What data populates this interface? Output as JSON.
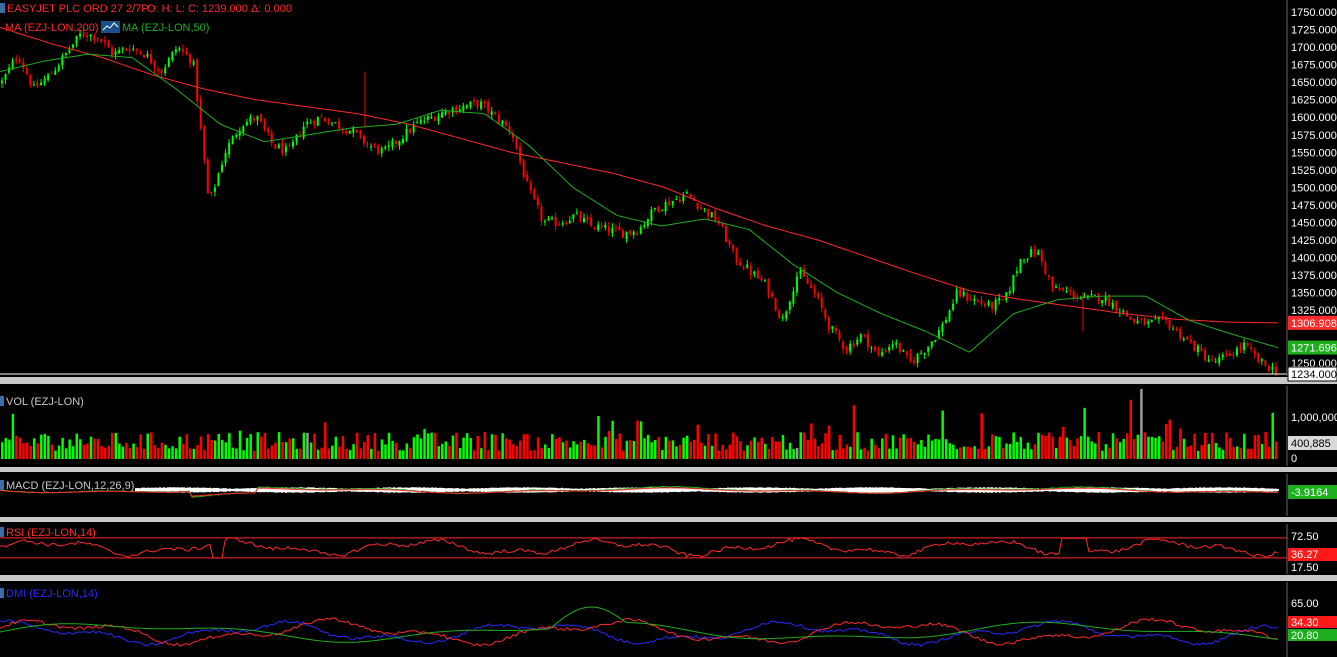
{
  "header": {
    "instrument": "EASYJET PLC ORD 27 2/7P",
    "ohlc": "O:    H:    L:    C: 1239.000   Δ: 0.000",
    "ma200_label": "MA (EZJ-LON,200)",
    "ma50_label": "MA (EZJ-LON,50)"
  },
  "colors": {
    "background": "#000000",
    "up": "#00ff00",
    "down": "#ff0000",
    "ma200": "#ff2a2a",
    "ma50": "#1fae1f",
    "separator": "#c8c8c8",
    "dmi_plus": "#2a2aff",
    "dmi_minus": "#ff2a2a",
    "adx": "#1fae1f"
  },
  "chart_data": [
    {
      "type": "candlestick",
      "title": "EASYJET PLC ORD 27 2/7P",
      "ylim": [
        1234,
        1750
      ],
      "y_ticks": [
        "1750.000",
        "1725.000",
        "1700.000",
        "1675.000",
        "1650.000",
        "1625.000",
        "1600.000",
        "1575.000",
        "1550.000",
        "1525.000",
        "1500.000",
        "1475.000",
        "1450.000",
        "1425.000",
        "1400.000",
        "1375.000",
        "1350.000",
        "1325.000",
        "1250.000"
      ],
      "price_path": [
        1650,
        1690,
        1640,
        1660,
        1690,
        1720,
        1715,
        1690,
        1700,
        1690,
        1665,
        1700,
        1680,
        1475,
        1550,
        1590,
        1600,
        1560,
        1550,
        1590,
        1600,
        1590,
        1580,
        1560,
        1550,
        1570,
        1590,
        1600,
        1610,
        1615,
        1620,
        1600,
        1580,
        1500,
        1450,
        1450,
        1460,
        1445,
        1440,
        1435,
        1440,
        1470,
        1480,
        1490,
        1470,
        1450,
        1400,
        1380,
        1360,
        1310,
        1380,
        1350,
        1300,
        1270,
        1290,
        1260,
        1280,
        1250,
        1270,
        1300,
        1350,
        1340,
        1330,
        1340,
        1400,
        1410,
        1355,
        1350,
        1340,
        1345,
        1330,
        1310,
        1305,
        1310,
        1290,
        1270,
        1250,
        1260,
        1275,
        1250,
        1239
      ],
      "series": [
        {
          "name": "MA (EZJ-LON,200)",
          "anchors": [
            1728,
            1705,
            1685,
            1660,
            1640,
            1625,
            1615,
            1605,
            1590,
            1570,
            1550,
            1535,
            1520,
            1500,
            1470,
            1445,
            1425,
            1400,
            1375,
            1352,
            1340,
            1330,
            1320,
            1312,
            1308,
            1306.9
          ]
        },
        {
          "name": "MA (EZJ-LON,50)",
          "anchors": [
            1665,
            1680,
            1690,
            1685,
            1640,
            1590,
            1565,
            1575,
            1585,
            1590,
            1610,
            1605,
            1560,
            1500,
            1460,
            1445,
            1455,
            1440,
            1390,
            1350,
            1320,
            1295,
            1265,
            1320,
            1340,
            1345,
            1345,
            1310,
            1290,
            1271.6
          ]
        }
      ],
      "last_labels": [
        {
          "text": "1306.908",
          "value": 1306.908,
          "color": "#ff2a2a"
        },
        {
          "text": "1271.696",
          "value": 1271.696,
          "color": "#1fae1f"
        },
        {
          "text": "1234.000",
          "value": 1234,
          "color": "#000000",
          "boxed": true
        }
      ]
    },
    {
      "type": "bar",
      "title": "VOL (EZJ-LON)",
      "ylim": [
        0,
        1300000
      ],
      "y_ticks": [
        "1,000,000",
        "0"
      ],
      "last_value_label": "400,885"
    },
    {
      "type": "line",
      "title": "MACD (EZJ-LON,12,26,9)",
      "last_value_label": "-3.9164"
    },
    {
      "type": "line",
      "title": "RSI (EZJ-LON,14)",
      "ylim": [
        0,
        100
      ],
      "y_ticks": [
        "72.50",
        "17.50"
      ],
      "bands": [
        72.5,
        30
      ],
      "last_value_label": "36.27"
    },
    {
      "type": "line",
      "title": "DMI (EZJ-LON,14)",
      "ylim": [
        0,
        80
      ],
      "y_ticks": [
        "65.00"
      ],
      "last_value_labels": [
        "34.30",
        "20.80"
      ]
    }
  ]
}
